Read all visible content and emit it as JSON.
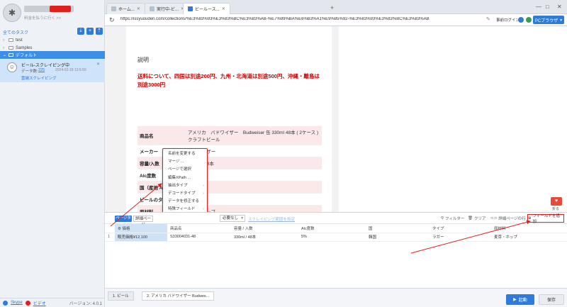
{
  "sidebar": {
    "plan_link": "料金を払うに行く >>",
    "all_tasks": "全てのタスク",
    "tree": [
      {
        "label": "test"
      },
      {
        "label": "Samples"
      },
      {
        "label": "デフォルト"
      }
    ],
    "task": {
      "title": "ビール-スクレイピング中",
      "data_label": "データ数:",
      "data_count": "225",
      "date": "2024-02-18 13:5:59",
      "cloud": "雲端スクレイピング"
    },
    "footer": {
      "skype": "Skype",
      "video": "ビデオ",
      "version": "バージョン: 4.0.1"
    }
  },
  "browser": {
    "tabs": [
      {
        "label": "ホーム..."
      },
      {
        "label": "実行中-ビ..."
      },
      {
        "label": "ビールース..."
      }
    ],
    "url": "https://issyuouden.com/collections/%E3%83%93%E3%83%BC%E3%83%AB-%E7%99%BA%E6%B3%A1%E9%85%92-%E3%83%93%E3%83%BC%E3%83%AB",
    "login": "事前ログイン",
    "pc_browser": "PCブラウザ"
  },
  "product": {
    "desc_title": "説明",
    "shipping": "送料について、四国は別途200円、九州・北海道は別途500円、沖縄・離島は別途3000円",
    "specs": [
      {
        "k": "商品名",
        "v": "アメリカ　バドワイザー　Budweiser 缶 330ml 48本 ( 2ケース ) クラフトビール",
        "hl": true
      },
      {
        "k": "メーカー",
        "v": "バドワイザー",
        "hl": false
      },
      {
        "k": "容量/入数",
        "v": "330ml / 48本",
        "hl": true
      },
      {
        "k": "Alc度数",
        "v": "5%",
        "hl": false
      },
      {
        "k": "国（産地 Area）",
        "v": "韓国",
        "hl": true
      },
      {
        "k": "ビールのタイプ",
        "v": "ラガー",
        "hl": false
      },
      {
        "k": "原材料",
        "v": "麦芽・ホップ",
        "hl": true
      },
      {
        "k": "保存",
        "v": "",
        "hl": false
      }
    ]
  },
  "context_menu": {
    "items": [
      {
        "label": "名前を変更する",
        "sub": false
      },
      {
        "label": "マージ ...",
        "sub": false
      },
      {
        "label": "ページで選択",
        "sub": false
      },
      {
        "label": "編集XPath ...",
        "sub": false
      },
      {
        "label": "抽出タイプ",
        "sub": true
      },
      {
        "label": "デコードタイプ",
        "sub": true
      },
      {
        "label": "データを修正する",
        "sub": false
      },
      {
        "label": "特殊フィールド",
        "sub": true
      },
      {
        "label": "列を削除",
        "sub": false
      }
    ]
  },
  "data_panel": {
    "page_type": "ページタイプ",
    "detail_page": "詳細ページ",
    "need": "必要なし",
    "scrape_range": "スクレイピング範囲を設定",
    "filter": "フィルター",
    "clear": "クリア",
    "detail_multi": "詳細ページの行 ...",
    "collapse": "折る",
    "add_field": "フィールドを追加",
    "columns": [
      "価格",
      "商品名",
      "容量 / 入数",
      "Alc度数",
      "国",
      "タイプ",
      "原材料"
    ],
    "rows": [
      {
        "idx": "1",
        "cells": [
          "販売価格¥12,100",
          "S33004031-48",
          "330ml / 48本",
          "5%",
          "韓国",
          "ラガー",
          "麦芽・ホップ"
        ]
      }
    ]
  },
  "bottom": {
    "tabs": [
      {
        "label": "1. ビール"
      },
      {
        "label": "2. アメリカ バドワイザー Budwes..."
      }
    ],
    "start": "起動",
    "save": "保存"
  }
}
